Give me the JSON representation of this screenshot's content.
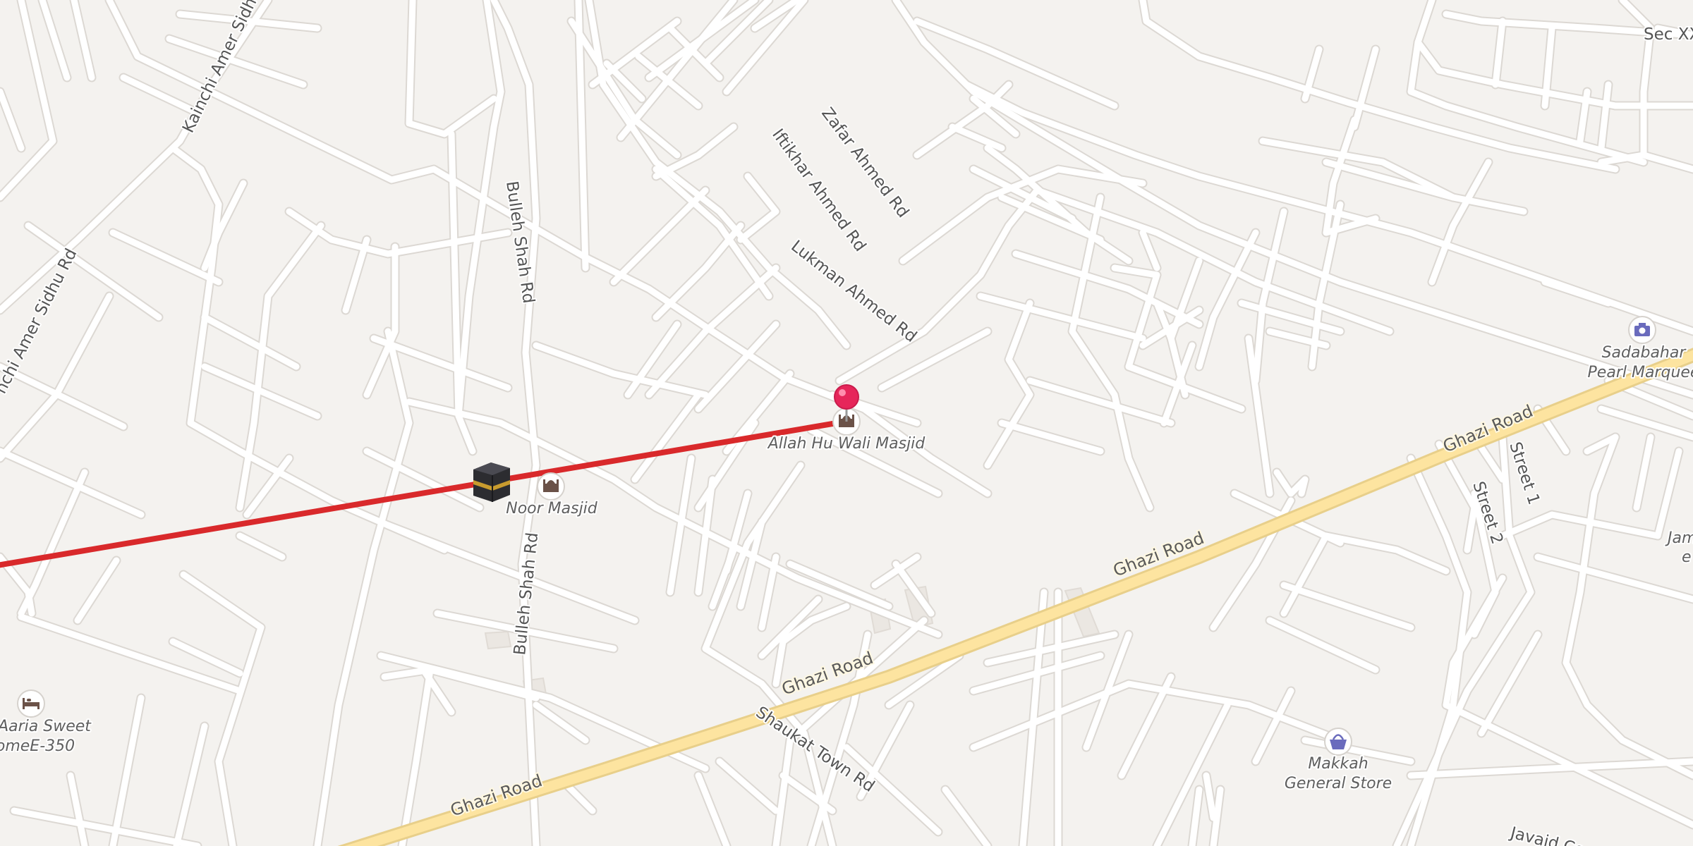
{
  "map": {
    "roads": {
      "kainchi_amer_sidhu_1": "Kainchi Amer Sidhu",
      "kainchi_amer_sidhu_2": "nchi Amer Sidhu Rd",
      "bulleh_shah_1": "Bulleh Shah Rd",
      "bulleh_shah_2": "Bulleh Shah Rd",
      "zafar_ahmed": "Zafar Ahmed Rd",
      "iftikhar_ahmed": "Iftikhar Ahmed Rd",
      "lukman_ahmed": "Lukman Ahmed Rd",
      "ghazi_1": "Ghazi Road",
      "ghazi_2": "Ghazi Road",
      "ghazi_3": "Ghazi Road",
      "ghazi_4": "Ghazi Road",
      "shaukat_town": "Shaukat Town Rd",
      "street_1": "Street 1",
      "street_2": "Street 2",
      "sec": "Sec XX",
      "javaid": "Javaid Co"
    },
    "pois": {
      "allah_hu_wali_masjid": "Allah Hu Wali Masjid",
      "noor_masjid": "Noor Masjid",
      "aaria_sweet_line1": "Aaria Sweet",
      "aaria_sweet_line2": "omeE-350",
      "sadabahar_line1": "Sadabahar",
      "sadabahar_line2": "Pearl Marquee",
      "makkah_line1": "Makkah",
      "makkah_line2": "General Store",
      "jam_line1": "Jam",
      "jam_line2": "e"
    },
    "icons": {
      "destination": "red-location-pin-icon",
      "qibla": "kaaba-icon",
      "mosque": "mosque-icon",
      "lodging": "bed-icon",
      "photo": "camera-icon",
      "shop": "shopping-basket-icon"
    },
    "colors": {
      "background": "#f4f2ef",
      "road": "#ffffff",
      "main_road": "#fde4a0",
      "qibla_line": "#d9292b",
      "pin": "#e6265a",
      "poi_icon": "#6a6bbd"
    }
  }
}
